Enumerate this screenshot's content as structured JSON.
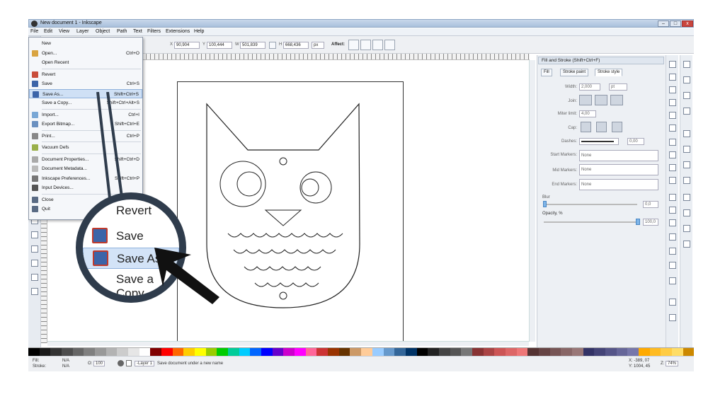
{
  "window": {
    "title": "New document 1 - Inkscape",
    "controls": [
      "–",
      "□",
      "x"
    ]
  },
  "menubar": [
    "File",
    "Edit",
    "View",
    "Layer",
    "Object",
    "Path",
    "Text",
    "Filters",
    "Extensions",
    "Help"
  ],
  "toolbar": {
    "x_label": "X",
    "x_value": "90,904",
    "y_label": "Y",
    "y_value": "100,444",
    "w_label": "W",
    "w_value": "501,839",
    "h_label": "H",
    "h_value": "668,436",
    "unit": "px",
    "affect_label": "Affect:"
  },
  "file_menu": {
    "items": [
      {
        "label": "New",
        "key": "",
        "icon": "arrow-right-icon"
      },
      {
        "label": "Open...",
        "key": "Ctrl+O",
        "icon": "open-folder-icon"
      },
      {
        "label": "Open Recent",
        "key": "",
        "icon": ""
      },
      {
        "label": "Revert",
        "key": "",
        "icon": "revert-icon"
      },
      {
        "label": "Save",
        "key": "Ctrl+S",
        "icon": "save-icon"
      },
      {
        "label": "Save As...",
        "key": "Shift+Ctrl+S",
        "icon": "save-as-icon"
      },
      {
        "label": "Save a Copy...",
        "key": "Shift+Ctrl+Alt+S",
        "icon": ""
      },
      {
        "label": "Import...",
        "key": "Ctrl+I",
        "icon": "import-icon"
      },
      {
        "label": "Export Bitmap...",
        "key": "Shift+Ctrl+E",
        "icon": "export-icon"
      },
      {
        "label": "Print...",
        "key": "Ctrl+P",
        "icon": "print-icon"
      },
      {
        "label": "Vacuum Defs",
        "key": "",
        "icon": "vacuum-icon"
      },
      {
        "label": "Document Properties...",
        "key": "Shift+Ctrl+D",
        "icon": "doc-properties-icon"
      },
      {
        "label": "Document Metadata...",
        "key": "",
        "icon": "doc-metadata-icon"
      },
      {
        "label": "Inkscape Preferences...",
        "key": "Shift+Ctrl+P",
        "icon": "preferences-icon"
      },
      {
        "label": "Input Devices...",
        "key": "",
        "icon": "input-devices-icon"
      },
      {
        "label": "Close",
        "key": "",
        "icon": "close-icon"
      },
      {
        "label": "Quit",
        "key": "",
        "icon": "quit-icon"
      }
    ],
    "highlighted": "Save As..."
  },
  "magnifier": {
    "items": [
      "Revert",
      "Save",
      "Save As...",
      "Save a Copy"
    ]
  },
  "ruler_ticks": [
    "-250",
    "-250",
    "-125",
    "0",
    "125",
    "250",
    "375",
    "500",
    "625",
    "750",
    "875",
    "1000",
    "1125"
  ],
  "fill_stroke": {
    "title": "Fill and Stroke (Shift+Ctrl+F)",
    "tabs": [
      "Fill",
      "Stroke paint",
      "Stroke style"
    ],
    "active_tab": "Stroke style",
    "width_label": "Width:",
    "width_value": "2,000",
    "width_unit": "pt",
    "join_label": "Join:",
    "miter_label": "Miter limit:",
    "miter_value": "4,00",
    "cap_label": "Cap:",
    "dashes_label": "Dashes:",
    "dashes_value": "0,00",
    "start_markers_label": "Start Markers:",
    "start_markers_value": "None",
    "mid_markers_label": "Mid Markers:",
    "mid_markers_value": "None",
    "end_markers_label": "End Markers:",
    "end_markers_value": "None",
    "blur_label": "Blur",
    "blur_value": "0,0",
    "opacity_label": "Opacity, %",
    "opacity_value": "100,0"
  },
  "status": {
    "fill_label": "Fill:",
    "fill_value": "N/A",
    "stroke_label": "Stroke:",
    "stroke_value": "N/A",
    "opacity_label": "O:",
    "opacity_value": "100",
    "layer": "-Layer 1",
    "message": "Save document under a new name",
    "coords": "X: -389, 07",
    "coords2": "Y: 1004, 45",
    "zoom_label": "Z:",
    "zoom_value": "74%"
  },
  "palette_colors": [
    "#000000",
    "#1a1a1a",
    "#333333",
    "#4d4d4d",
    "#666666",
    "#808080",
    "#999999",
    "#b3b3b3",
    "#cccccc",
    "#e6e6e6",
    "#ffffff",
    "#800000",
    "#ff0000",
    "#ff6600",
    "#ffcc00",
    "#ffff00",
    "#99cc00",
    "#00cc00",
    "#00cc99",
    "#00ccff",
    "#0066ff",
    "#0000ff",
    "#6600cc",
    "#cc00cc",
    "#ff00ff",
    "#ff6699",
    "#cc3333",
    "#993300",
    "#663300",
    "#cc9966",
    "#ffcc99",
    "#99ccff",
    "#6699cc",
    "#336699",
    "#003366",
    "#000000",
    "#222222",
    "#444444",
    "#555555",
    "#777777",
    "#883333",
    "#aa4444",
    "#cc5555",
    "#dd6666",
    "#ee7777",
    "#553333",
    "#664444",
    "#775555",
    "#886666",
    "#997777",
    "#333366",
    "#444477",
    "#555588",
    "#666699",
    "#7777aa",
    "#ffaa00",
    "#ffbb22",
    "#ffcc44",
    "#ffdd66",
    "#cc8800"
  ]
}
